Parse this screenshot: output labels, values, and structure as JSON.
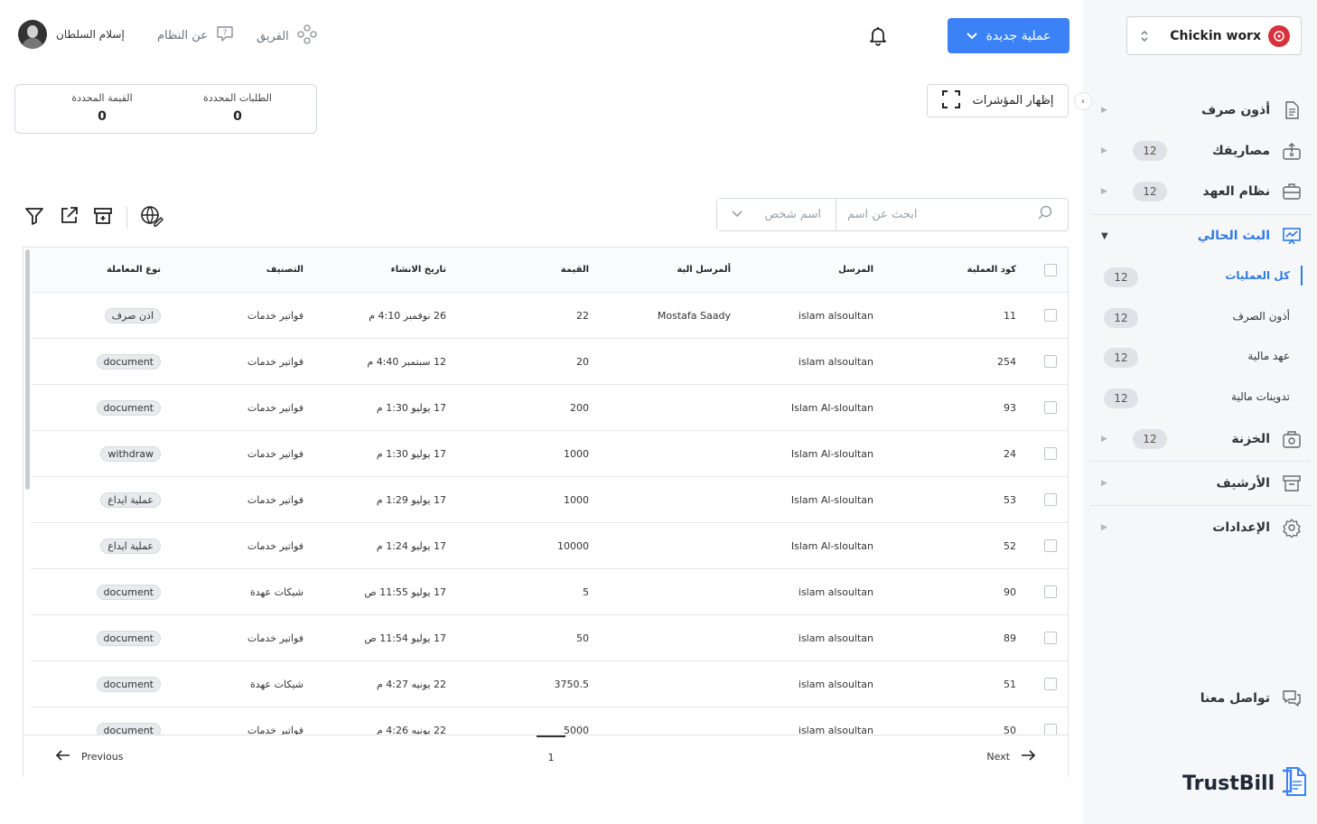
{
  "sidebar": {
    "company": "Chickin worx",
    "collapse_icon": "chevron-left",
    "items": [
      {
        "label": "أذون صرف",
        "badge": ""
      },
      {
        "label": "مصاريفك",
        "badge": "12"
      },
      {
        "label": "نظام العهد",
        "badge": "12"
      },
      {
        "label": "البث الحالي",
        "badge": ""
      },
      {
        "label": "الخزنة",
        "badge": "12"
      },
      {
        "label": "الأرشيف",
        "badge": ""
      },
      {
        "label": "الإعدادات",
        "badge": ""
      }
    ],
    "sub_items": [
      {
        "label": "كل العمليات",
        "badge": "12"
      },
      {
        "label": "أذون الصرف",
        "badge": "12"
      },
      {
        "label": "عهد مالية",
        "badge": "12"
      },
      {
        "label": "تدوينات مالية",
        "badge": "12"
      }
    ],
    "contact": "تواصل معنا",
    "brand": "TrustBill"
  },
  "header": {
    "user_name": "إسلام السلطان",
    "about": "عن النظام",
    "team": "الفريق",
    "new_operation": "عملية جديدة",
    "show_indicators": "إظهار المؤشرات"
  },
  "stats": {
    "selected_requests_label": "الطلبات المحددة",
    "selected_requests_value": "0",
    "selected_value_label": "القيمة المحددة",
    "selected_value_value": "0"
  },
  "toolbar": {
    "search_placeholder": "ابحث عن اسم",
    "person_placeholder": "اسم شخص"
  },
  "table": {
    "columns": [
      "كود العملية",
      "المرسل",
      "ألمرسل الية",
      "القيمة",
      "تاريخ الانشاء",
      "التصنيف",
      "نوع المعاملة"
    ],
    "rows": [
      {
        "code": "11",
        "sender": "islam alsoultan",
        "recipient": "Mostafa Saady",
        "value": "22",
        "date": "26 نوفمبر 4:10 م",
        "category": "فواتير خدمات",
        "type": "اذن صرف"
      },
      {
        "code": "254",
        "sender": "islam alsoultan",
        "recipient": "",
        "value": "20",
        "date": "12 سبتمبر 4:40 م",
        "category": "فواتير خدمات",
        "type": "document"
      },
      {
        "code": "93",
        "sender": "Islam Al-sloultan",
        "recipient": "",
        "value": "200",
        "date": "17 يوليو 1:30 م",
        "category": "فواتير خدمات",
        "type": "document"
      },
      {
        "code": "24",
        "sender": "Islam Al-sloultan",
        "recipient": "",
        "value": "1000",
        "date": "17 يوليو 1:30 م",
        "category": "فواتير خدمات",
        "type": "withdraw"
      },
      {
        "code": "53",
        "sender": "Islam Al-sloultan",
        "recipient": "",
        "value": "1000",
        "date": "17 يوليو 1:29 م",
        "category": "فواتير خدمات",
        "type": "عملية ايداع"
      },
      {
        "code": "52",
        "sender": "Islam Al-sloultan",
        "recipient": "",
        "value": "10000",
        "date": "17 يوليو 1:24 م",
        "category": "فواتير خدمات",
        "type": "عملية ايداع"
      },
      {
        "code": "90",
        "sender": "islam alsoultan",
        "recipient": "",
        "value": "5",
        "date": "17 يوليو 11:55 ص",
        "category": "شيكات عهدة",
        "type": "document"
      },
      {
        "code": "89",
        "sender": "islam alsoultan",
        "recipient": "",
        "value": "50",
        "date": "17 يوليو 11:54 ص",
        "category": "فواتير خدمات",
        "type": "document"
      },
      {
        "code": "51",
        "sender": "islam alsoultan",
        "recipient": "",
        "value": "3750.5",
        "date": "22 يونيه 4:27 م",
        "category": "شيكات عهدة",
        "type": "document"
      },
      {
        "code": "50",
        "sender": "islam alsoultan",
        "recipient": "",
        "value": "5000",
        "date": "22 يونيه 4:26 م",
        "category": "فواتير خدمات",
        "type": "document"
      }
    ]
  },
  "pager": {
    "previous": "Previous",
    "next": "Next",
    "page": "1"
  },
  "colors": {
    "accent": "#3b82f6",
    "active": "#2f7be6",
    "sidebar_bg": "#f6f7f9"
  }
}
